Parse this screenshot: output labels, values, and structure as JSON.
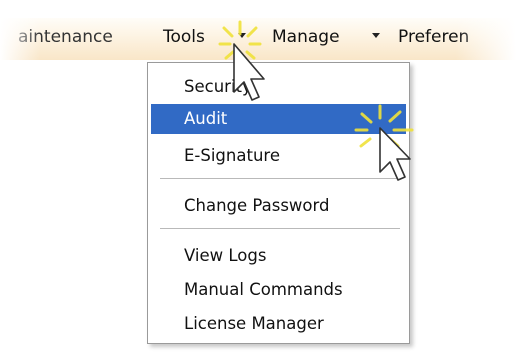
{
  "menubar": {
    "items": [
      {
        "label": "aintenance"
      },
      {
        "label": "Tools"
      },
      {
        "label": "Manage"
      },
      {
        "label": "Preferen"
      }
    ]
  },
  "tools_menu": {
    "items": [
      {
        "label": "Security",
        "state": "normal"
      },
      {
        "label": "Audit",
        "state": "highlighted"
      },
      {
        "label": "E-Signature",
        "state": "normal"
      },
      {
        "label": "Change Password",
        "state": "normal"
      },
      {
        "label": "View Logs",
        "state": "normal"
      },
      {
        "label": "Manual Commands",
        "state": "normal"
      },
      {
        "label": "License Manager",
        "state": "normal"
      }
    ]
  },
  "colors": {
    "highlight": "#316ac5",
    "menubar_tint": "#fdf3e2",
    "click_flash": "#f0e23a"
  },
  "icons": [
    "dropdown-arrow-icon",
    "mouse-pointer-icon",
    "click-flash-icon"
  ]
}
